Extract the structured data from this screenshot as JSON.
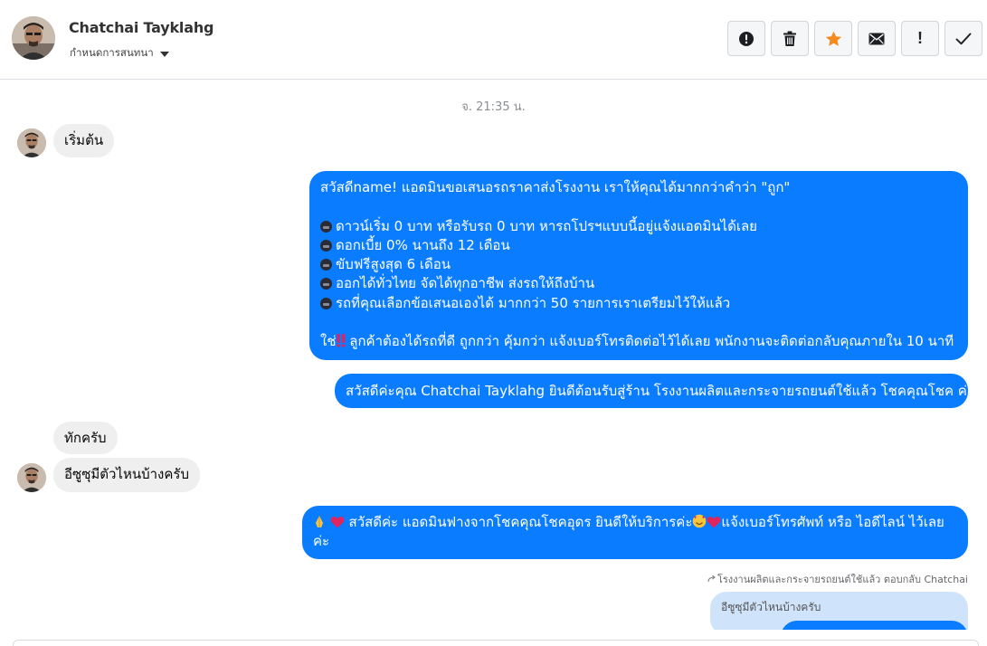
{
  "header": {
    "contact_name": "Chatchai Tayklahg",
    "subtitle": "กำหนดการสนทนา",
    "avatar_icon": "user-photo",
    "toolbar": [
      {
        "name": "spam-button",
        "icon": "alert-circle-icon"
      },
      {
        "name": "delete-button",
        "icon": "trash-icon"
      },
      {
        "name": "star-button",
        "icon": "star-icon",
        "color": "#f58b1f"
      },
      {
        "name": "mark-unread-button",
        "icon": "envelope-icon"
      },
      {
        "name": "important-button",
        "icon": "exclamation-icon",
        "glyph": "!"
      },
      {
        "name": "done-button",
        "icon": "check-icon"
      }
    ]
  },
  "thread": {
    "timestamp": "จ. 21:35 น.",
    "msg1": "เริ่มต้น",
    "msg2": {
      "line1": "สวัสดีname! แอดมินขอเสนอรถราคาส่งโรงงาน เราให้คุณได้มากกว่าคำว่า \"ถูก\"",
      "bullets": [
        "ดาวน์เริ่ม 0 บาท หรือรับรถ 0 บาท หารถโปรฯแบบนี้อยู่แจ้งแอดมินได้เลย",
        "ดอกเบี้ย 0% นานถึง 12 เดือน",
        "ขับฟรีสูงสุด 6 เดือน",
        "ออกได้ทั่วไทย จัดได้ทุกอาชีพ ส่งรถให้ถึงบ้าน",
        "รถที่คุณเลือกข้อเสนอเองได้ มากกว่า 50 รายการเราเตรียมไว้ให้แล้ว"
      ],
      "last_pre": "ใช่",
      "last_post": " ลูกค้าต้องได้รถที่ดี ถูกกว่า คุ้มกว่า แจ้งเบอร์โทรติดต่อไว้ได้เลย พนักงานจะติดต่อกลับคุณภายใน 10 นาที"
    },
    "msg3": "สวัสดีค่ะคุณ Chatchai Tayklahg ยินดีต้อนรับสู่ร้าน โรงงานผลิตและกระจายรถยนต์ใช้แล้ว โชคคุณโชค ค่ะ",
    "msg4": "ทักครับ",
    "msg5": "อีซูซุมีตัวไหนบ้างครับ",
    "msg6": {
      "part1": " สวัสดีค่ะ แอดมินฟางจากโชคคุณโชคอุดร ยินดีให้บริการค่ะ",
      "part2": "แจ้งเบอร์โทรศัพท์ หรือ ไอดีไลน์  ไว้เลย",
      "part3": "ค่ะ"
    },
    "reply_meta": "โรงงานผลิตและกระจายรถยนต์ใช้แล้ว ตอบกลับ Chatchai",
    "reply_quote": "อีซูซุมีตัวไหนบ้างครับ"
  },
  "colors": {
    "outgoing_bubble": "#0a7cff",
    "incoming_bubble": "#efefef",
    "star": "#f58b1f",
    "reply_quote_bg": "#cfe3fb"
  }
}
